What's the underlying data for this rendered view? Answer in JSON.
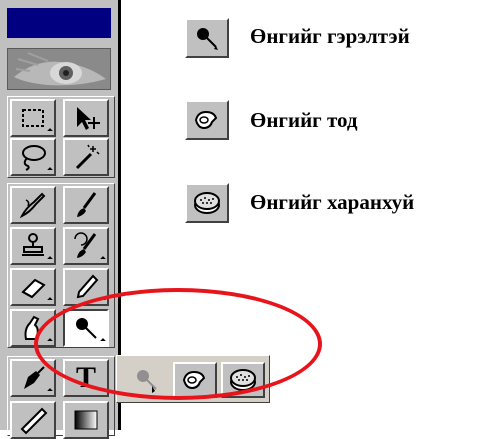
{
  "toolbox": {
    "tools": [
      {
        "name": "rect-marquee-icon",
        "active": false
      },
      {
        "name": "move-icon",
        "active": false
      },
      {
        "name": "lasso-icon",
        "active": false
      },
      {
        "name": "magic-wand-icon",
        "active": false
      },
      {
        "name": "airbrush-icon",
        "active": false
      },
      {
        "name": "brush-icon",
        "active": false
      },
      {
        "name": "stamp-icon",
        "active": false
      },
      {
        "name": "history-brush-icon",
        "active": false
      },
      {
        "name": "eraser-icon",
        "active": false
      },
      {
        "name": "pencil-icon",
        "active": false
      },
      {
        "name": "smudge-icon",
        "active": false
      },
      {
        "name": "dodge-icon",
        "active": true
      },
      {
        "name": "pen-icon",
        "active": false
      },
      {
        "name": "type-icon",
        "active": false
      },
      {
        "name": "measure-icon",
        "active": false
      },
      {
        "name": "gradient-icon",
        "active": false
      }
    ],
    "type_tool_glyph": "T"
  },
  "flyout": {
    "items": [
      {
        "name": "dodge-icon",
        "dimmed": true
      },
      {
        "name": "burn-icon",
        "dimmed": false
      },
      {
        "name": "sponge-icon",
        "dimmed": false
      }
    ]
  },
  "legend": [
    {
      "icon": "dodge-icon",
      "label": "Өнгийг гэрэлтэй"
    },
    {
      "icon": "burn-icon",
      "label": "Өнгийг тод"
    },
    {
      "icon": "sponge-icon",
      "label": "Өнгийг харанхуй"
    }
  ],
  "colors": {
    "titlebar": "#000080",
    "panel": "#c0c0c0",
    "highlight_ring": "#e8141c"
  }
}
